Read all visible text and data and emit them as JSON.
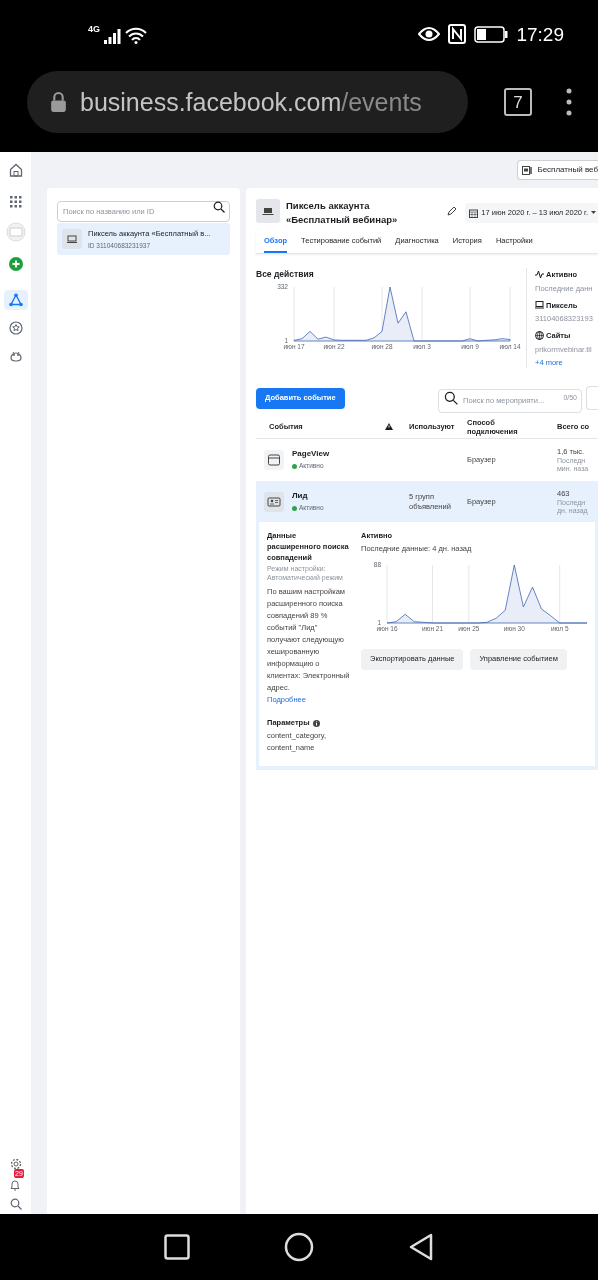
{
  "status_bar": {
    "network": "4G",
    "time": "17:29"
  },
  "browser": {
    "url_host": "business.facebook.com",
    "url_path": "/events",
    "tab_count": "7"
  },
  "rail": {
    "items": [
      {
        "kind": "home",
        "selected": false
      },
      {
        "kind": "apps",
        "selected": false
      },
      {
        "kind": "account",
        "selected": false
      },
      {
        "kind": "create",
        "selected": false
      },
      {
        "kind": "events",
        "selected": true
      },
      {
        "kind": "ads",
        "selected": false
      },
      {
        "kind": "audience",
        "selected": false
      }
    ],
    "notifications_badge": "29"
  },
  "account_switcher": {
    "label": "Бесплатный веб"
  },
  "left_panel": {
    "search": {
      "placeholder": "Поиск по названию или ID"
    },
    "items": [
      {
        "title": "Пиксель аккаунта «Бесплатный в...",
        "id": "ID 311040683231937",
        "selected": true
      }
    ]
  },
  "pixel": {
    "title_line1": "Пиксель аккаунта",
    "title_line2": "«Бесплатный вебинар»",
    "date_range": "17 июн 2020 г. – 13 июл 2020 г.",
    "tabs": [
      {
        "label": "Обзор",
        "selected": true
      },
      {
        "label": "Тестирование событий",
        "selected": false
      },
      {
        "label": "Диагностика",
        "selected": false
      },
      {
        "label": "История",
        "selected": false
      },
      {
        "label": "Настройки",
        "selected": false
      }
    ]
  },
  "overview": {
    "chart_data": {
      "type": "area",
      "title": "Все действия",
      "categories": [
        "июн 17",
        null,
        null,
        null,
        null,
        "июн 22",
        null,
        null,
        null,
        null,
        null,
        "июн 28",
        null,
        null,
        null,
        null,
        "июл 3",
        null,
        null,
        null,
        null,
        null,
        "июл 9",
        null,
        null,
        null,
        null,
        "июл 14"
      ],
      "series": [
        {
          "color": "#4267b2",
          "values": [
            5,
            15,
            60,
            12,
            25,
            8,
            5,
            5,
            5,
            5,
            20,
            60,
            332,
            110,
            180,
            1,
            1,
            1,
            1,
            1,
            1,
            1,
            15,
            1,
            5,
            8,
            15,
            10
          ]
        }
      ],
      "ylim": [
        1,
        332
      ],
      "yticks": [
        1,
        332
      ],
      "grid": true
    },
    "info": [
      {
        "kind": "status",
        "label": "Активно",
        "value": "Последние данн"
      },
      {
        "kind": "pixel",
        "label": "Пиксель",
        "value": "31104068323193"
      },
      {
        "kind": "sites",
        "label": "Сайты",
        "value": "prikormvebinar.til",
        "more": "+4 more"
      }
    ]
  },
  "events": {
    "add_button": "Добавить событие",
    "search": {
      "placeholder": "Поиск по мероприяти...",
      "count": "0/50"
    },
    "columns": [
      "События",
      "Используют",
      "Способ подключения",
      "Всего со"
    ],
    "rows": [
      {
        "kind": "page",
        "name": "PageView",
        "status": "Активно",
        "used_by": "",
        "connection": "Браузер",
        "total": "1,6 тыс.",
        "note_lines": [
          "Последн",
          "мин. наза"
        ],
        "expanded": false
      },
      {
        "kind": "lead",
        "name": "Лид",
        "status": "Активно",
        "used_by": "5 групп объявлений",
        "connection": "Браузер",
        "total": "463",
        "note_lines": [
          "Последн",
          "дн. назад"
        ],
        "expanded": true
      }
    ],
    "detail": {
      "title": "Данные расширенного поиска совпадений",
      "mode": "Режим настройки: Автоматический режим",
      "description": "По вашим настройкам расширенного поиска совпадений 89 % событий \"Лид\" получают следующую хешированную информацию о клиентах: Электронный адрес.",
      "link": "Подробнее",
      "params_title": "Параметры",
      "params": "content_category, content_name",
      "status": "Активно",
      "last_data": "Последние данные: 4 дн. назад",
      "chart_data": {
        "type": "area",
        "categories": [
          "июн 16",
          null,
          null,
          null,
          null,
          "июн 21",
          null,
          null,
          null,
          "июн 25",
          null,
          null,
          null,
          null,
          "июн 30",
          null,
          null,
          null,
          null,
          "июл 5",
          null,
          null,
          null
        ],
        "series": [
          {
            "color": "#4267b2",
            "values": [
              1,
              3,
              14,
              3,
              2,
              1,
              1,
              1,
              1,
              1,
              1,
              2,
              8,
              20,
              88,
              25,
              55,
              22,
              12,
              1,
              1,
              1,
              1
            ]
          }
        ],
        "ylim": [
          1,
          88
        ],
        "yticks": [
          1,
          88
        ],
        "grid": true
      },
      "buttons": [
        "Экспортировать данные",
        "Управление событием"
      ]
    }
  }
}
